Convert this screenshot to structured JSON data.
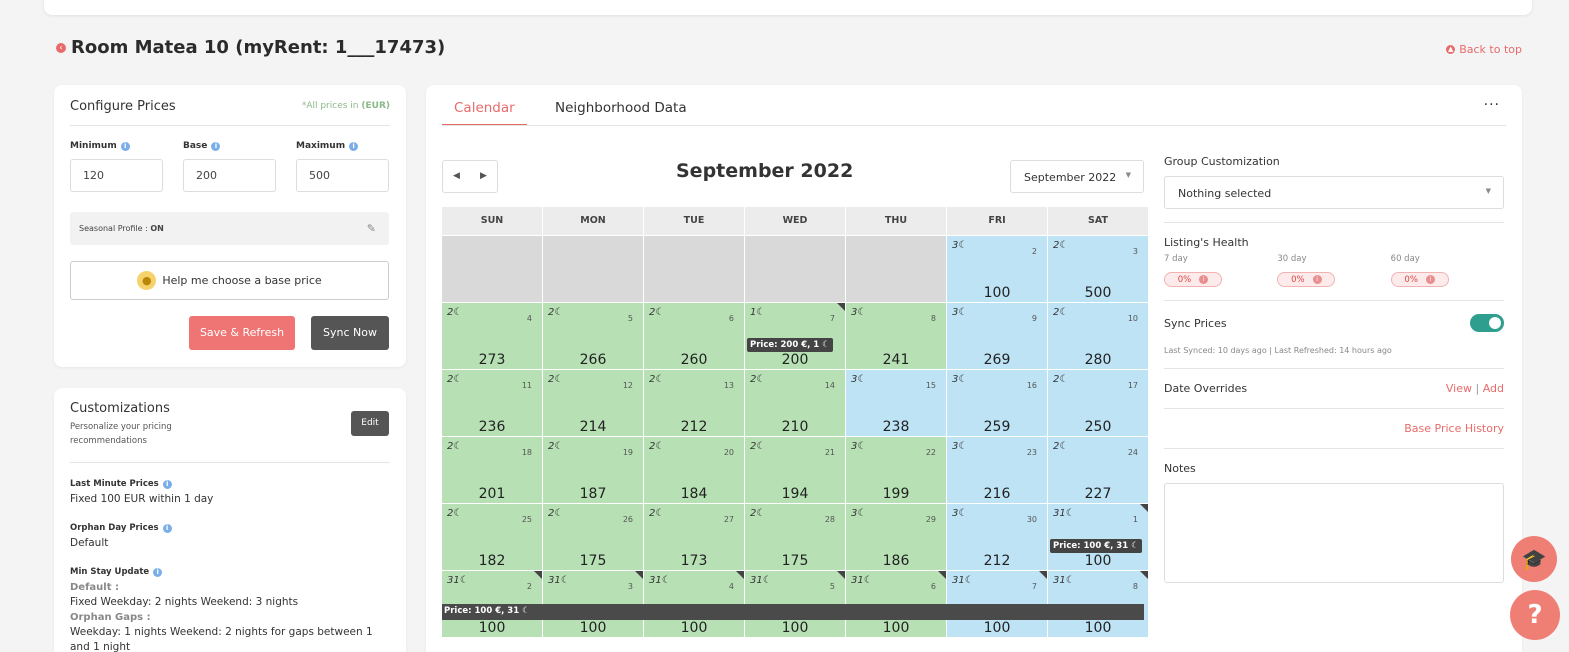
{
  "page": {
    "room_title": "Room Matea 10 (myRent: 1___17473)",
    "back_to_top": "Back to top"
  },
  "configure": {
    "title": "Configure Prices",
    "note_prefix": "*All prices in",
    "note_currency": "(EUR)",
    "min_label": "Minimum",
    "min_value": "120",
    "base_label": "Base",
    "base_value": "200",
    "max_label": "Maximum",
    "max_value": "500",
    "seasonal_label": "Seasonal Profile : ",
    "seasonal_state": "ON",
    "help_label": "Help me choose a base price",
    "save_label": "Save & Refresh",
    "sync_label": "Sync Now"
  },
  "customizations": {
    "title": "Customizations",
    "subtitle": "Personalize your pricing recommendations",
    "edit_label": "Edit",
    "last_minute_title": "Last Minute Prices",
    "last_minute_value": "Fixed 100 EUR within 1 day",
    "orphan_title": "Orphan Day Prices",
    "orphan_value": "Default",
    "minstay_title": "Min Stay Update",
    "minstay_default_label": "Default :",
    "minstay_default_value": "Fixed Weekday: 2 nights Weekend: 3 nights",
    "minstay_gaps_label": "Orphan Gaps :",
    "minstay_gaps_value": "Weekday: 1 nights Weekend: 2 nights for gaps between 1 and 1 night"
  },
  "main": {
    "tab_calendar": "Calendar",
    "tab_neighborhood": "Neighborhood Data",
    "more": "···",
    "month_title": "September 2022",
    "month_select": "September 2022",
    "prev": "◀",
    "next": "▶",
    "days": [
      "SUN",
      "MON",
      "TUE",
      "WED",
      "THU",
      "FRI",
      "SAT"
    ],
    "tooltip_wed7": "Price: 200 €, 1 ☾",
    "tooltip_sat1": "Price: 100 €, 31 ☾",
    "tooltip_bar": "Price: 100 €, 31 ☾"
  },
  "calendar_cells": [
    {
      "empty": true
    },
    {
      "empty": true
    },
    {
      "empty": true
    },
    {
      "empty": true
    },
    {
      "empty": true
    },
    {
      "ms": "3☾",
      "day": "2",
      "price": "100",
      "color": "blue"
    },
    {
      "ms": "2☾",
      "day": "3",
      "price": "500",
      "color": "blue"
    },
    {
      "ms": "2☾",
      "day": "4",
      "price": "273",
      "color": "green"
    },
    {
      "ms": "2☾",
      "day": "5",
      "price": "266",
      "color": "green"
    },
    {
      "ms": "2☾",
      "day": "6",
      "price": "260",
      "color": "green"
    },
    {
      "ms": "1☾",
      "day": "7",
      "price": "200",
      "color": "green",
      "corner": true,
      "tip": "wed7"
    },
    {
      "ms": "3☾",
      "day": "8",
      "price": "241",
      "color": "green"
    },
    {
      "ms": "3☾",
      "day": "9",
      "price": "269",
      "color": "blue"
    },
    {
      "ms": "2☾",
      "day": "10",
      "price": "280",
      "color": "blue"
    },
    {
      "ms": "2☾",
      "day": "11",
      "price": "236",
      "color": "green"
    },
    {
      "ms": "2☾",
      "day": "12",
      "price": "214",
      "color": "green"
    },
    {
      "ms": "2☾",
      "day": "13",
      "price": "212",
      "color": "green"
    },
    {
      "ms": "2☾",
      "day": "14",
      "price": "210",
      "color": "green"
    },
    {
      "ms": "3☾",
      "day": "15",
      "price": "238",
      "color": "blue"
    },
    {
      "ms": "3☾",
      "day": "16",
      "price": "259",
      "color": "blue"
    },
    {
      "ms": "2☾",
      "day": "17",
      "price": "250",
      "color": "blue"
    },
    {
      "ms": "2☾",
      "day": "18",
      "price": "201",
      "color": "green"
    },
    {
      "ms": "2☾",
      "day": "19",
      "price": "187",
      "color": "green"
    },
    {
      "ms": "2☾",
      "day": "20",
      "price": "184",
      "color": "green"
    },
    {
      "ms": "2☾",
      "day": "21",
      "price": "194",
      "color": "green"
    },
    {
      "ms": "3☾",
      "day": "22",
      "price": "199",
      "color": "green"
    },
    {
      "ms": "3☾",
      "day": "23",
      "price": "216",
      "color": "blue"
    },
    {
      "ms": "2☾",
      "day": "24",
      "price": "227",
      "color": "blue"
    },
    {
      "ms": "2☾",
      "day": "25",
      "price": "182",
      "color": "green"
    },
    {
      "ms": "2☾",
      "day": "26",
      "price": "175",
      "color": "green"
    },
    {
      "ms": "2☾",
      "day": "27",
      "price": "173",
      "color": "green"
    },
    {
      "ms": "2☾",
      "day": "28",
      "price": "175",
      "color": "green"
    },
    {
      "ms": "3☾",
      "day": "29",
      "price": "186",
      "color": "green"
    },
    {
      "ms": "3☾",
      "day": "30",
      "price": "212",
      "color": "blue"
    },
    {
      "ms": "31☾",
      "day": "1",
      "price": "100",
      "color": "blue",
      "corner": true,
      "tip": "sat1"
    },
    {
      "ms": "31☾",
      "day": "2",
      "price": "100",
      "color": "green",
      "corner": true
    },
    {
      "ms": "31☾",
      "day": "3",
      "price": "100",
      "color": "green",
      "corner": true
    },
    {
      "ms": "31☾",
      "day": "4",
      "price": "100",
      "color": "green",
      "corner": true
    },
    {
      "ms": "31☾",
      "day": "5",
      "price": "100",
      "color": "green",
      "corner": true
    },
    {
      "ms": "31☾",
      "day": "6",
      "price": "100",
      "color": "green",
      "corner": true
    },
    {
      "ms": "31☾",
      "day": "7",
      "price": "100",
      "color": "blue",
      "corner": true
    },
    {
      "ms": "31☾",
      "day": "8",
      "price": "100",
      "color": "blue",
      "corner": true
    }
  ],
  "side": {
    "group_label": "Group Customization",
    "group_value": "Nothing selected",
    "health_label": "Listing's Health",
    "health": [
      {
        "period": "7 day",
        "value": "0%"
      },
      {
        "period": "30 day",
        "value": "0%"
      },
      {
        "period": "60 day",
        "value": "0%"
      }
    ],
    "sync_label": "Sync Prices",
    "sync_note": "Last Synced: 10 days ago | Last Refreshed: 14 hours ago",
    "overrides_label": "Date Overrides",
    "view": "View",
    "sep": "|",
    "add": "Add",
    "base_history": "Base Price History",
    "notes_label": "Notes"
  },
  "colors": {
    "accent": "#e86b6b",
    "green_cell": "#b7e1b5",
    "blue_cell": "#bde3f5",
    "toggle": "#2e9e8e"
  }
}
